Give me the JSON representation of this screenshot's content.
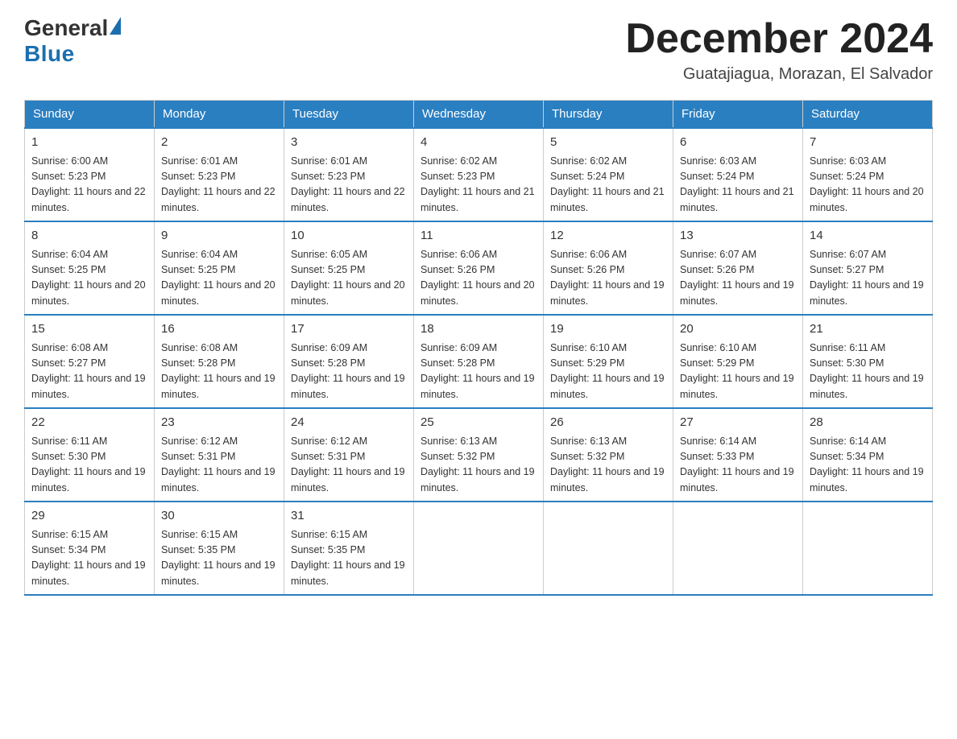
{
  "header": {
    "logo_general": "General",
    "logo_blue": "Blue",
    "month_title": "December 2024",
    "location": "Guatajiagua, Morazan, El Salvador"
  },
  "weekdays": [
    "Sunday",
    "Monday",
    "Tuesday",
    "Wednesday",
    "Thursday",
    "Friday",
    "Saturday"
  ],
  "weeks": [
    [
      {
        "day": "1",
        "sunrise": "6:00 AM",
        "sunset": "5:23 PM",
        "daylight": "11 hours and 22 minutes."
      },
      {
        "day": "2",
        "sunrise": "6:01 AM",
        "sunset": "5:23 PM",
        "daylight": "11 hours and 22 minutes."
      },
      {
        "day": "3",
        "sunrise": "6:01 AM",
        "sunset": "5:23 PM",
        "daylight": "11 hours and 22 minutes."
      },
      {
        "day": "4",
        "sunrise": "6:02 AM",
        "sunset": "5:23 PM",
        "daylight": "11 hours and 21 minutes."
      },
      {
        "day": "5",
        "sunrise": "6:02 AM",
        "sunset": "5:24 PM",
        "daylight": "11 hours and 21 minutes."
      },
      {
        "day": "6",
        "sunrise": "6:03 AM",
        "sunset": "5:24 PM",
        "daylight": "11 hours and 21 minutes."
      },
      {
        "day": "7",
        "sunrise": "6:03 AM",
        "sunset": "5:24 PM",
        "daylight": "11 hours and 20 minutes."
      }
    ],
    [
      {
        "day": "8",
        "sunrise": "6:04 AM",
        "sunset": "5:25 PM",
        "daylight": "11 hours and 20 minutes."
      },
      {
        "day": "9",
        "sunrise": "6:04 AM",
        "sunset": "5:25 PM",
        "daylight": "11 hours and 20 minutes."
      },
      {
        "day": "10",
        "sunrise": "6:05 AM",
        "sunset": "5:25 PM",
        "daylight": "11 hours and 20 minutes."
      },
      {
        "day": "11",
        "sunrise": "6:06 AM",
        "sunset": "5:26 PM",
        "daylight": "11 hours and 20 minutes."
      },
      {
        "day": "12",
        "sunrise": "6:06 AM",
        "sunset": "5:26 PM",
        "daylight": "11 hours and 19 minutes."
      },
      {
        "day": "13",
        "sunrise": "6:07 AM",
        "sunset": "5:26 PM",
        "daylight": "11 hours and 19 minutes."
      },
      {
        "day": "14",
        "sunrise": "6:07 AM",
        "sunset": "5:27 PM",
        "daylight": "11 hours and 19 minutes."
      }
    ],
    [
      {
        "day": "15",
        "sunrise": "6:08 AM",
        "sunset": "5:27 PM",
        "daylight": "11 hours and 19 minutes."
      },
      {
        "day": "16",
        "sunrise": "6:08 AM",
        "sunset": "5:28 PM",
        "daylight": "11 hours and 19 minutes."
      },
      {
        "day": "17",
        "sunrise": "6:09 AM",
        "sunset": "5:28 PM",
        "daylight": "11 hours and 19 minutes."
      },
      {
        "day": "18",
        "sunrise": "6:09 AM",
        "sunset": "5:28 PM",
        "daylight": "11 hours and 19 minutes."
      },
      {
        "day": "19",
        "sunrise": "6:10 AM",
        "sunset": "5:29 PM",
        "daylight": "11 hours and 19 minutes."
      },
      {
        "day": "20",
        "sunrise": "6:10 AM",
        "sunset": "5:29 PM",
        "daylight": "11 hours and 19 minutes."
      },
      {
        "day": "21",
        "sunrise": "6:11 AM",
        "sunset": "5:30 PM",
        "daylight": "11 hours and 19 minutes."
      }
    ],
    [
      {
        "day": "22",
        "sunrise": "6:11 AM",
        "sunset": "5:30 PM",
        "daylight": "11 hours and 19 minutes."
      },
      {
        "day": "23",
        "sunrise": "6:12 AM",
        "sunset": "5:31 PM",
        "daylight": "11 hours and 19 minutes."
      },
      {
        "day": "24",
        "sunrise": "6:12 AM",
        "sunset": "5:31 PM",
        "daylight": "11 hours and 19 minutes."
      },
      {
        "day": "25",
        "sunrise": "6:13 AM",
        "sunset": "5:32 PM",
        "daylight": "11 hours and 19 minutes."
      },
      {
        "day": "26",
        "sunrise": "6:13 AM",
        "sunset": "5:32 PM",
        "daylight": "11 hours and 19 minutes."
      },
      {
        "day": "27",
        "sunrise": "6:14 AM",
        "sunset": "5:33 PM",
        "daylight": "11 hours and 19 minutes."
      },
      {
        "day": "28",
        "sunrise": "6:14 AM",
        "sunset": "5:34 PM",
        "daylight": "11 hours and 19 minutes."
      }
    ],
    [
      {
        "day": "29",
        "sunrise": "6:15 AM",
        "sunset": "5:34 PM",
        "daylight": "11 hours and 19 minutes."
      },
      {
        "day": "30",
        "sunrise": "6:15 AM",
        "sunset": "5:35 PM",
        "daylight": "11 hours and 19 minutes."
      },
      {
        "day": "31",
        "sunrise": "6:15 AM",
        "sunset": "5:35 PM",
        "daylight": "11 hours and 19 minutes."
      },
      null,
      null,
      null,
      null
    ]
  ],
  "labels": {
    "sunrise_prefix": "Sunrise: ",
    "sunset_prefix": "Sunset: ",
    "daylight_prefix": "Daylight: "
  }
}
